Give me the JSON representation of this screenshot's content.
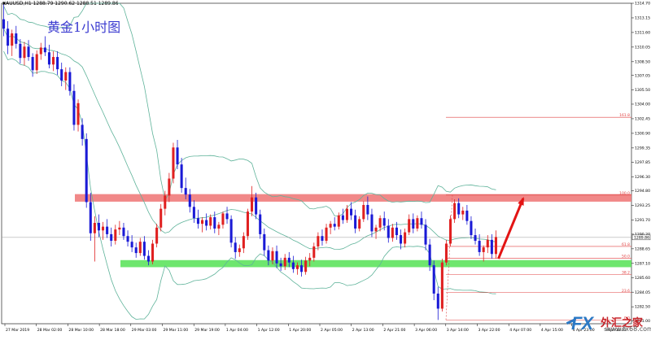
{
  "header": {
    "symbol_line": "XAUUSD,H1  1288.79 1290.62 1288.51 1289.86"
  },
  "title": "黄金1小时图",
  "watermark": {
    "fx": "FX",
    "cn": "外汇之家",
    "url": "www.fx68.com"
  },
  "colors": {
    "bull": "#e02020",
    "bear": "#1a1ad6",
    "band": "#5fb39a",
    "resistance_zone": "#ef7b7b",
    "support_zone": "#5ee35e",
    "fib_line": "#e04040",
    "arrow": "#e31414"
  },
  "chart_data": {
    "type": "candlestick",
    "symbol": "XAUUSD",
    "timeframe": "H1",
    "ohlc_header": {
      "open": 1288.79,
      "high": 1290.62,
      "low": 1288.51,
      "close": 1289.86
    },
    "ylim": [
      1280.7,
      1314.7
    ],
    "y_ticks": [
      1314.7,
      1313.15,
      1311.6,
      1310.05,
      1308.5,
      1307.05,
      1305.5,
      1304.0,
      1302.45,
      1300.9,
      1299.35,
      1297.85,
      1296.3,
      1294.8,
      1293.25,
      1291.7,
      1290.2,
      1288.65,
      1287.1,
      1285.6,
      1284.05,
      1282.5,
      1281.0
    ],
    "x_tick_labels": [
      "27 Mar 2019",
      "28 Mar 02:00",
      "28 Mar 10:00",
      "28 Mar 18:00",
      "29 Mar 03:00",
      "29 Mar 11:00",
      "29 Mar 19:00",
      "1 Apr 04:00",
      "1 Apr 12:00",
      "1 Apr 20:00",
      "2 Apr 05:00",
      "2 Apr 13:00",
      "2 Apr 21:00",
      "3 Apr 06:00",
      "3 Apr 14:00",
      "3 Apr 22:00",
      "4 Apr 07:00",
      "4 Apr 15:00",
      "4 Apr 23:00",
      "5 Apr 08:00"
    ],
    "current_price": 1289.86,
    "zones": [
      {
        "name": "resistance",
        "from": 1293.65,
        "to": 1294.45
      },
      {
        "name": "support",
        "from": 1286.7,
        "to": 1287.45
      }
    ],
    "fib_levels": [
      {
        "label": "161.8",
        "price": 1302.6
      },
      {
        "label": "100.0",
        "price": 1294.35
      },
      {
        "label": "61.8",
        "price": 1288.9
      },
      {
        "label": "50.0",
        "price": 1287.65
      },
      {
        "label": "38.2",
        "price": 1285.9
      },
      {
        "label": "23.6",
        "price": 1284.0
      },
      {
        "label": "0.0",
        "price": 1281.1
      }
    ],
    "projection_arrow": {
      "from": 1287.6,
      "to": 1294.0
    },
    "candles": [
      [
        1313.0,
        1314.7,
        1311.2,
        1312.0
      ],
      [
        1312.0,
        1312.8,
        1309.3,
        1310.2
      ],
      [
        1310.2,
        1311.9,
        1309.1,
        1311.5
      ],
      [
        1311.5,
        1312.3,
        1309.9,
        1310.4
      ],
      [
        1310.4,
        1310.9,
        1308.3,
        1308.9
      ],
      [
        1308.9,
        1310.6,
        1308.1,
        1310.1
      ],
      [
        1310.1,
        1310.8,
        1308.6,
        1309.0
      ],
      [
        1309.0,
        1309.4,
        1306.9,
        1307.6
      ],
      [
        1307.6,
        1309.7,
        1307.2,
        1309.3
      ],
      [
        1309.3,
        1310.5,
        1308.7,
        1310.0
      ],
      [
        1310.0,
        1311.2,
        1309.1,
        1309.5
      ],
      [
        1309.5,
        1310.3,
        1307.8,
        1308.2
      ],
      [
        1308.2,
        1309.6,
        1307.5,
        1309.0
      ],
      [
        1309.0,
        1309.6,
        1307.1,
        1307.7
      ],
      [
        1307.7,
        1308.4,
        1305.9,
        1306.5
      ],
      [
        1306.5,
        1307.9,
        1305.5,
        1307.4
      ],
      [
        1307.4,
        1307.9,
        1304.9,
        1305.4
      ],
      [
        1305.4,
        1306.1,
        1301.2,
        1301.8
      ],
      [
        1301.8,
        1304.5,
        1301.1,
        1304.1
      ],
      [
        1301.8,
        1302.5,
        1299.6,
        1300.3
      ],
      [
        1300.3,
        1300.9,
        1293.0,
        1293.6
      ],
      [
        1293.6,
        1294.6,
        1289.5,
        1290.3
      ],
      [
        1290.3,
        1292.1,
        1287.3,
        1291.4
      ],
      [
        1291.4,
        1292.3,
        1289.9,
        1290.6
      ],
      [
        1290.6,
        1291.5,
        1289.6,
        1291.0
      ],
      [
        1291.0,
        1291.8,
        1289.8,
        1290.2
      ],
      [
        1290.2,
        1290.9,
        1288.9,
        1289.5
      ],
      [
        1289.5,
        1291.2,
        1289.1,
        1290.7
      ],
      [
        1290.7,
        1291.6,
        1290.1,
        1290.9
      ],
      [
        1290.9,
        1291.4,
        1289.6,
        1290.0
      ],
      [
        1290.0,
        1290.6,
        1288.9,
        1289.4
      ],
      [
        1289.4,
        1290.1,
        1288.3,
        1288.8
      ],
      [
        1288.8,
        1289.3,
        1287.7,
        1288.2
      ],
      [
        1288.2,
        1289.8,
        1287.9,
        1289.4
      ],
      [
        1289.4,
        1290.0,
        1287.5,
        1287.9
      ],
      [
        1287.9,
        1288.5,
        1286.9,
        1287.3
      ],
      [
        1287.3,
        1289.6,
        1287.0,
        1289.2
      ],
      [
        1289.2,
        1291.3,
        1288.8,
        1290.9
      ],
      [
        1290.9,
        1293.4,
        1290.5,
        1292.9
      ],
      [
        1292.9,
        1294.8,
        1292.2,
        1294.3
      ],
      [
        1294.3,
        1296.7,
        1293.6,
        1296.1
      ],
      [
        1296.1,
        1299.9,
        1295.6,
        1299.4
      ],
      [
        1299.4,
        1300.2,
        1297.1,
        1297.6
      ],
      [
        1297.6,
        1298.3,
        1294.6,
        1295.1
      ],
      [
        1295.1,
        1296.2,
        1293.9,
        1294.4
      ],
      [
        1294.4,
        1295.0,
        1292.5,
        1293.1
      ],
      [
        1293.1,
        1293.8,
        1291.4,
        1291.9
      ],
      [
        1291.9,
        1292.8,
        1290.8,
        1291.3
      ],
      [
        1291.3,
        1292.0,
        1290.4,
        1291.7
      ],
      [
        1291.7,
        1292.4,
        1290.6,
        1291.1
      ],
      [
        1291.1,
        1292.3,
        1290.7,
        1292.0
      ],
      [
        1292.0,
        1292.6,
        1290.3,
        1290.8
      ],
      [
        1290.8,
        1291.5,
        1290.1,
        1291.2
      ],
      [
        1291.2,
        1292.6,
        1290.8,
        1292.4
      ],
      [
        1292.4,
        1293.1,
        1291.3,
        1291.8
      ],
      [
        1291.8,
        1292.2,
        1288.8,
        1289.3
      ],
      [
        1289.3,
        1289.9,
        1287.6,
        1288.3
      ],
      [
        1288.3,
        1289.1,
        1287.8,
        1288.7
      ],
      [
        1288.7,
        1290.4,
        1288.2,
        1290.0
      ],
      [
        1290.0,
        1292.9,
        1289.6,
        1292.6
      ],
      [
        1292.6,
        1295.3,
        1292.1,
        1294.1
      ],
      [
        1294.1,
        1294.6,
        1291.8,
        1292.3
      ],
      [
        1292.3,
        1292.8,
        1289.7,
        1290.2
      ],
      [
        1290.2,
        1290.8,
        1287.9,
        1288.5
      ],
      [
        1288.5,
        1289.0,
        1286.9,
        1287.4
      ],
      [
        1287.4,
        1288.8,
        1287.0,
        1288.4
      ],
      [
        1288.4,
        1289.0,
        1286.6,
        1287.1
      ],
      [
        1287.1,
        1287.7,
        1286.3,
        1286.8
      ],
      [
        1286.8,
        1288.1,
        1286.4,
        1287.7
      ],
      [
        1287.7,
        1288.3,
        1286.7,
        1287.2
      ],
      [
        1287.2,
        1287.9,
        1286.1,
        1286.5
      ],
      [
        1286.5,
        1287.2,
        1285.9,
        1286.9
      ],
      [
        1286.9,
        1287.5,
        1285.7,
        1286.2
      ],
      [
        1286.2,
        1287.8,
        1285.9,
        1287.4
      ],
      [
        1287.4,
        1288.2,
        1286.8,
        1287.7
      ],
      [
        1287.7,
        1289.3,
        1287.3,
        1288.9
      ],
      [
        1288.9,
        1290.4,
        1288.5,
        1290.0
      ],
      [
        1290.0,
        1290.7,
        1289.0,
        1289.5
      ],
      [
        1289.5,
        1291.3,
        1289.2,
        1290.9
      ],
      [
        1290.9,
        1291.6,
        1290.2,
        1291.3
      ],
      [
        1291.3,
        1292.0,
        1290.6,
        1291.0
      ],
      [
        1291.0,
        1292.5,
        1290.7,
        1292.2
      ],
      [
        1292.2,
        1292.9,
        1291.3,
        1291.7
      ],
      [
        1291.7,
        1293.3,
        1291.4,
        1292.9
      ],
      [
        1292.9,
        1293.6,
        1291.7,
        1292.2
      ],
      [
        1292.2,
        1292.8,
        1290.3,
        1290.8
      ],
      [
        1290.8,
        1292.1,
        1290.5,
        1291.8
      ],
      [
        1291.8,
        1293.7,
        1291.5,
        1293.3
      ],
      [
        1293.3,
        1294.2,
        1291.7,
        1292.3
      ],
      [
        1292.3,
        1292.9,
        1289.9,
        1290.5
      ],
      [
        1290.5,
        1291.2,
        1289.7,
        1290.9
      ],
      [
        1290.9,
        1292.2,
        1290.5,
        1291.9
      ],
      [
        1291.9,
        1292.6,
        1290.6,
        1291.1
      ],
      [
        1291.1,
        1291.8,
        1289.3,
        1289.8
      ],
      [
        1289.8,
        1291.3,
        1289.4,
        1290.9
      ],
      [
        1290.9,
        1291.5,
        1289.6,
        1290.1
      ],
      [
        1290.1,
        1290.7,
        1288.6,
        1289.2
      ],
      [
        1289.2,
        1290.8,
        1288.8,
        1290.4
      ],
      [
        1290.4,
        1292.3,
        1290.1,
        1291.8
      ],
      [
        1291.8,
        1292.4,
        1290.3,
        1290.8
      ],
      [
        1290.8,
        1292.2,
        1290.5,
        1291.9
      ],
      [
        1291.9,
        1292.6,
        1290.8,
        1291.2
      ],
      [
        1291.2,
        1291.8,
        1288.5,
        1289.1
      ],
      [
        1289.1,
        1289.7,
        1286.3,
        1286.9
      ],
      [
        1286.9,
        1287.4,
        1283.2,
        1283.9
      ],
      [
        1283.9,
        1284.6,
        1281.1,
        1282.3
      ],
      [
        1282.3,
        1287.6,
        1282.0,
        1287.2
      ],
      [
        1287.2,
        1289.6,
        1286.9,
        1289.2
      ],
      [
        1289.2,
        1292.2,
        1288.9,
        1291.8
      ],
      [
        1291.8,
        1293.9,
        1291.4,
        1293.5
      ],
      [
        1293.5,
        1294.0,
        1291.9,
        1292.3
      ],
      [
        1292.3,
        1293.1,
        1291.7,
        1292.7
      ],
      [
        1292.7,
        1293.3,
        1291.2,
        1291.6
      ],
      [
        1291.6,
        1292.1,
        1289.7,
        1290.1
      ],
      [
        1290.1,
        1290.8,
        1289.1,
        1289.5
      ],
      [
        1289.5,
        1290.2,
        1287.9,
        1288.3
      ],
      [
        1288.3,
        1289.0,
        1287.3,
        1288.8
      ],
      [
        1288.8,
        1290.1,
        1288.2,
        1289.6
      ],
      [
        1289.6,
        1290.2,
        1287.6,
        1288.1
      ],
      [
        1288.1,
        1290.6,
        1287.6,
        1289.9
      ]
    ]
  }
}
